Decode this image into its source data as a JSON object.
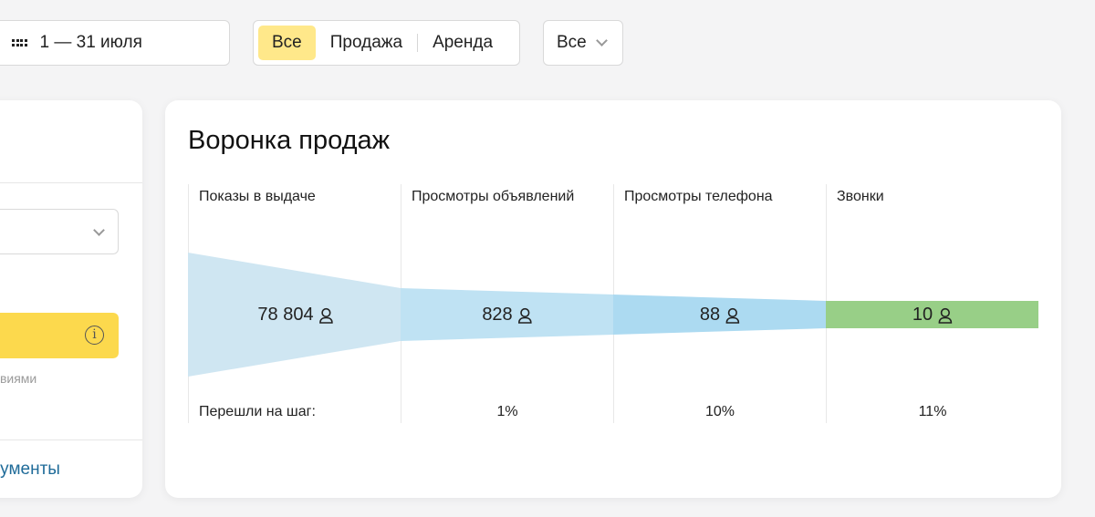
{
  "filters": {
    "date_range": "1 — 31 июля",
    "deal_types": [
      {
        "label": "Все",
        "active": true
      },
      {
        "label": "Продажа",
        "active": false
      },
      {
        "label": "Аренда",
        "active": false
      }
    ],
    "category_select": "Все"
  },
  "left_panel": {
    "note_fragment": "условиями",
    "link_fragment": "документы"
  },
  "funnel": {
    "title": "Воронка продаж",
    "stages": [
      {
        "label": "Показы в выдаче",
        "value": "78 804",
        "count": 78804,
        "conversion": "",
        "color": "#cfe6f2"
      },
      {
        "label": "Просмотры объявлений",
        "value": "828",
        "count": 828,
        "conversion": "1%",
        "color": "#bfe2f3"
      },
      {
        "label": "Просмотры телефона",
        "value": "88",
        "count": 88,
        "conversion": "10%",
        "color": "#acdaf1"
      },
      {
        "label": "Звонки",
        "value": "10",
        "count": 10,
        "conversion": "11%",
        "color": "#98cf87"
      }
    ],
    "conversion_label": "Перешли на шаг:",
    "value_icon": "person-icon"
  }
}
